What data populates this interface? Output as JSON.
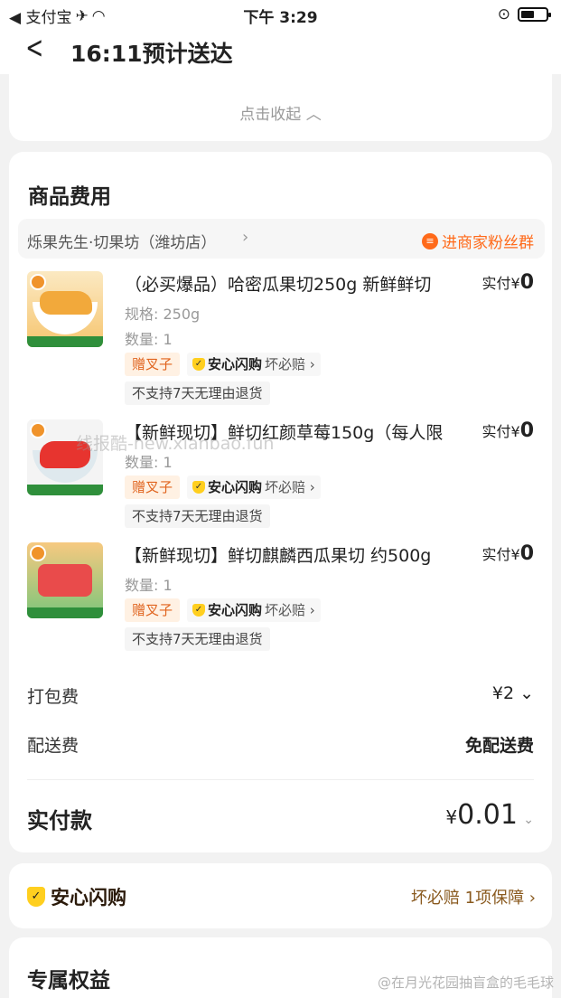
{
  "status_bar": {
    "back_app": "◀ 支付宝",
    "time": "下午 3:29"
  },
  "nav": {
    "title": "16:11预计送达"
  },
  "collapse_link": "点击收起 ︿",
  "goods": {
    "section_title": "商品费用",
    "shop_name": "烁果先生·切果坊（潍坊店）",
    "fans_link": "进商家粉丝群",
    "items": [
      {
        "name": "（必买爆品）哈密瓜果切250g 新鲜鲜切",
        "price_prefix": "实付¥",
        "price": "0",
        "spec": "规格: 250g",
        "qty": "数量: 1",
        "gift": "赠叉子",
        "safe_brand": "安心闪购",
        "safe_promise": "坏必赔 ›",
        "refund": "不支持7天无理由退货"
      },
      {
        "name": "【新鲜现切】鲜切红颜草莓150g（每人限",
        "price_prefix": "实付¥",
        "price": "0",
        "qty": "数量: 1",
        "gift": "赠叉子",
        "safe_brand": "安心闪购",
        "safe_promise": "坏必赔 ›",
        "refund": "不支持7天无理由退货"
      },
      {
        "name": "【新鲜现切】鲜切麒麟西瓜果切 约500g",
        "price_prefix": "实付¥",
        "price": "0",
        "qty": "数量: 1",
        "gift": "赠叉子",
        "safe_brand": "安心闪购",
        "safe_promise": "坏必赔 ›",
        "refund": "不支持7天无理由退货"
      }
    ],
    "watermark": "线报酷-new.xianbao.fun",
    "packing_fee_label": "打包费",
    "packing_fee_value": "¥2 ⌄",
    "delivery_fee_label": "配送费",
    "delivery_fee_value": "免配送费",
    "total_label": "实付款",
    "total_currency": "¥",
    "total_value": "0.01"
  },
  "safe_card": {
    "title": "安心闪购",
    "link": "坏必赔 1项保障 ›"
  },
  "benefit": {
    "title": "专属权益"
  },
  "weibo_mark": "@在月光花园抽盲盒的毛毛球",
  "colors": {
    "accent_orange": "#ff6a1a",
    "safe_yellow": "#ffcf1f"
  }
}
